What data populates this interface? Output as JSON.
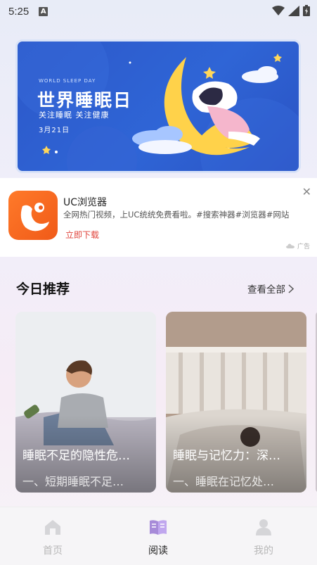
{
  "status_bar": {
    "time": "5:25",
    "notification_icon": "A"
  },
  "banner": {
    "en_title": "WORLD SLEEP DAY",
    "title": "世界睡眠日",
    "subtitle": "关注睡眠  关注健康",
    "date": "3月21日"
  },
  "ad": {
    "app_name": "UC浏览器",
    "description": "全网热门视频，上UC统统免费看啦。#搜索神器#浏览器#网站",
    "cta": "立即下载",
    "label": "广告",
    "close_icon": "close-icon"
  },
  "recommend": {
    "title": "今日推荐",
    "view_all": "查看全部",
    "cards": [
      {
        "title": "睡眠不足的隐性危…",
        "summary": "一、短期睡眠不足…"
      },
      {
        "title": "睡眠与记忆力：深…",
        "summary": "一、睡眠在记忆处…"
      }
    ]
  },
  "tabbar": {
    "items": [
      {
        "label": "首页",
        "icon": "home-icon",
        "active": false
      },
      {
        "label": "阅读",
        "icon": "book-icon",
        "active": true
      },
      {
        "label": "我的",
        "icon": "user-icon",
        "active": false
      }
    ],
    "active_color": "#a78bd8",
    "inactive_color": "#d0d0d0"
  }
}
